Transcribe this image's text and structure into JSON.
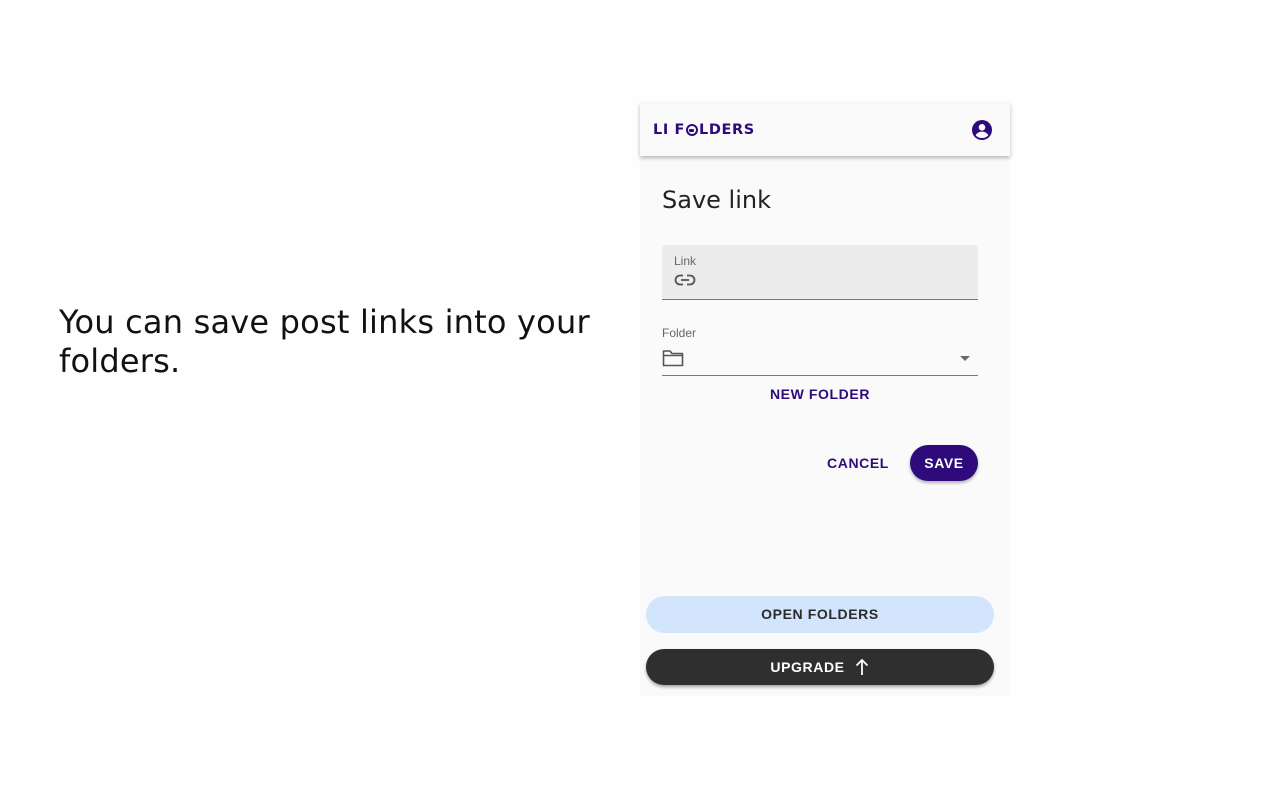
{
  "promo": {
    "text": "You can save post links into your folders."
  },
  "app": {
    "logo_prefix": "LI F",
    "logo_suffix": "LDERS",
    "account_icon": "account-circle-icon",
    "accent_color": "#2e0a7a"
  },
  "form": {
    "title": "Save link",
    "link_label": "Link",
    "link_value": "",
    "link_icon": "link-icon",
    "folder_label": "Folder",
    "folder_value": "",
    "folder_icon": "folder-icon",
    "new_folder_label": "NEW FOLDER",
    "cancel_label": "CANCEL",
    "save_label": "SAVE"
  },
  "footer": {
    "open_folders_label": "OPEN FOLDERS",
    "upgrade_label": "UPGRADE",
    "upgrade_icon": "arrow-up-icon"
  }
}
